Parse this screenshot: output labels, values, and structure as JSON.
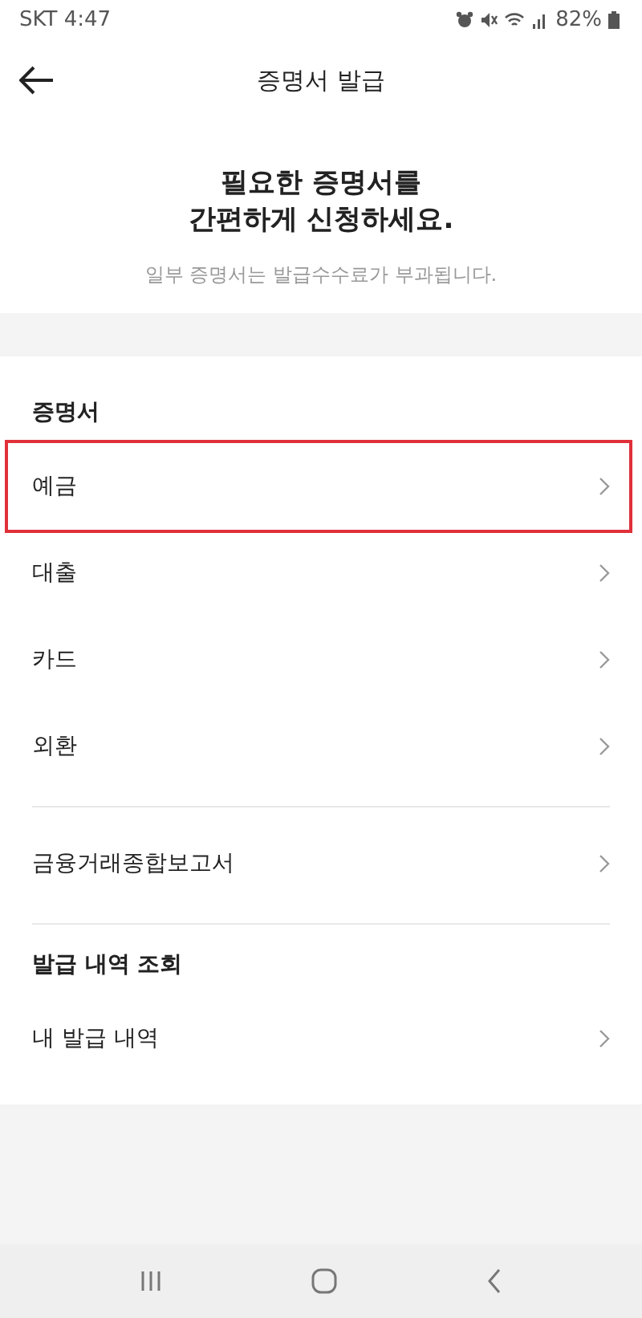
{
  "status_bar": {
    "carrier_time": "SKT 4:47",
    "battery": "82%"
  },
  "header": {
    "title": "증명서 발급"
  },
  "intro": {
    "headline_lines": [
      "필요한 증명서를",
      "간편하게 신청하세요."
    ],
    "note": "일부 증명서는 발급수수료가 부과됩니다."
  },
  "sections": [
    {
      "title": "증명서",
      "groups": [
        [
          {
            "label": "예금",
            "highlighted": true
          },
          {
            "label": "대출",
            "highlighted": false
          },
          {
            "label": "카드",
            "highlighted": false
          },
          {
            "label": "외환",
            "highlighted": false
          }
        ],
        [
          {
            "label": "금융거래종합보고서",
            "highlighted": false
          }
        ]
      ]
    },
    {
      "title": "발급 내역 조회",
      "groups": [
        [
          {
            "label": "내 발급 내역",
            "highlighted": false
          }
        ]
      ]
    }
  ]
}
